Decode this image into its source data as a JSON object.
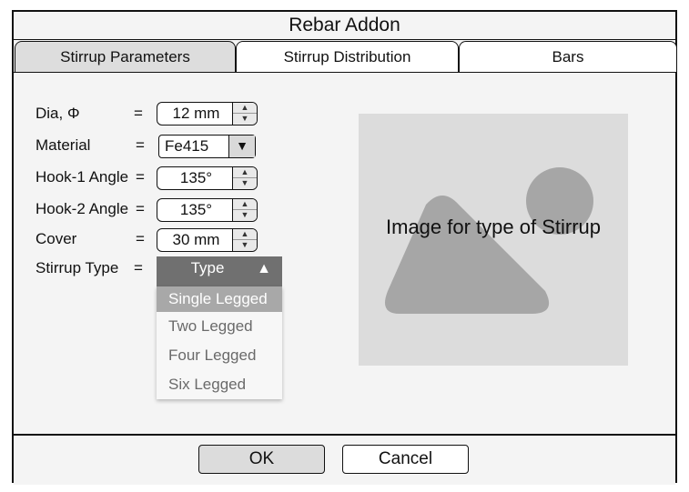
{
  "window": {
    "title": "Rebar Addon"
  },
  "tabs": [
    {
      "label": "Stirrup Parameters",
      "active": true
    },
    {
      "label": "Stirrup Distribution",
      "active": false
    },
    {
      "label": "Bars",
      "active": false
    }
  ],
  "form": {
    "dia": {
      "label": "Dia, Φ",
      "eq": "=",
      "value": "12 mm"
    },
    "material": {
      "label": "Material",
      "eq": "=",
      "value": "Fe415"
    },
    "hook1": {
      "label": "Hook-1 Angle",
      "eq": "=",
      "value": "135°"
    },
    "hook2": {
      "label": "Hook-2 Angle",
      "eq": "=",
      "value": "135°"
    },
    "cover": {
      "label": "Cover",
      "eq": "=",
      "value": "30 mm"
    },
    "stirrup_type": {
      "label": "Stirrup Type",
      "eq": "=",
      "header": "Type",
      "options": [
        "Single Legged",
        "Two Legged",
        "Four Legged",
        "Six Legged"
      ],
      "highlighted": "Single Legged"
    }
  },
  "image_placeholder": {
    "caption": "Image for type of Stirrup"
  },
  "footer": {
    "ok_label": "OK",
    "cancel_label": "Cancel"
  },
  "icons": {
    "spin_up": "triangle-up-icon",
    "spin_down": "triangle-down-icon",
    "dropdown": "caret-down-icon",
    "collapse": "caret-up-icon"
  },
  "colors": {
    "accent_header": "#707070",
    "highlight": "#a8a8a8",
    "placeholder_bg": "#dcdcdc",
    "shape": "#a6a6a6"
  }
}
